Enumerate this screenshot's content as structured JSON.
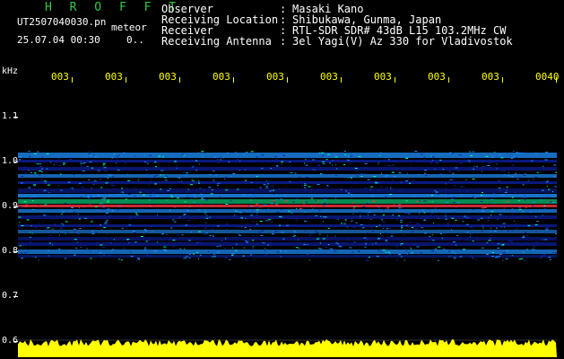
{
  "header": {
    "app_title": "H R O F F T",
    "filename": "UT2507040030.pn",
    "mode": "meteor",
    "datetime": "25.07.04 00:30",
    "count": "0..",
    "info": [
      {
        "key": "Observer",
        "sep": ":",
        "value": "Masaki Kano"
      },
      {
        "key": "Receiving Location",
        "sep": ":",
        "value": "Shibukawa, Gunma, Japan"
      },
      {
        "key": "Receiver",
        "sep": ":",
        "value": "RTL-SDR SDR# 43dB L15 103.2MHz CW"
      },
      {
        "key": "Receiving Antenna",
        "sep": ":",
        "value": "3el Yagi(V) Az 330 for Vladivostok"
      }
    ]
  },
  "axes": {
    "freq_unit": "kHz",
    "freq_ticks": [
      "1.1",
      "1.0",
      "0.9",
      "0.8",
      "0.7",
      "0.6"
    ],
    "time_ticks": [
      "003",
      "003",
      "003",
      "003",
      "003",
      "003",
      "003",
      "003",
      "003",
      "0040"
    ]
  },
  "colors": {
    "background": "#000000",
    "time_ticks": "#ffff00",
    "signal_low": "#0b1f9e",
    "signal_mid": "#1e90ff",
    "signal_high": "#00ff99",
    "signal_peak": "#ff3344",
    "noise_bar": "#ffff00"
  }
}
